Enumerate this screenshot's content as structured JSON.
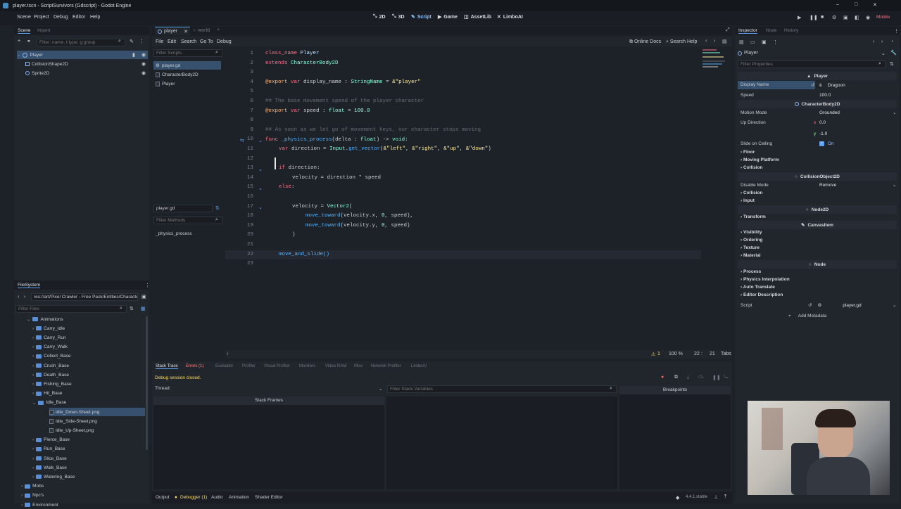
{
  "window": {
    "title": "player.tscn - ScriptSurvivors (Gdscript) - Godot Engine",
    "minimize": "–",
    "maximize": "□",
    "close": "✕"
  },
  "menu": {
    "scene": "Scene",
    "project": "Project",
    "debug": "Debug",
    "editor": "Editor",
    "help": "Help"
  },
  "workspaces": {
    "w2d": "2D",
    "w3d": "3D",
    "script": "Script",
    "game": "Game",
    "assetlib": "AssetLib",
    "limbo": "LimboAI"
  },
  "renderer": "Mobile",
  "scene_dock": {
    "tab_scene": "Scene",
    "tab_import": "Import",
    "filter_placeholder": "Filter: name, t:type, g:group",
    "nodes": [
      "Player",
      "CollisionShape2D",
      "Sprite2D"
    ]
  },
  "editor_tabs": {
    "tab1": "player",
    "tab2": "world"
  },
  "script_menu": {
    "file": "File",
    "edit": "Edit",
    "search": "Search",
    "goto": "Go To",
    "debug": "Debug",
    "online_docs": "Online Docs",
    "search_help": "Search Help"
  },
  "scripts_panel": {
    "filter_placeholder": "Filter Scripts",
    "items": [
      "player.gd",
      "CharacterBody2D",
      "Player"
    ],
    "current": "player.gd",
    "methods_placeholder": "Filter Methods",
    "methods": [
      "_physics_process"
    ]
  },
  "code": {
    "l1a": "class_name",
    "l1b": " Player",
    "l2a": "extends",
    "l2b": " CharacterBody2D",
    "l4a": "@export",
    "l4b": " var",
    "l4c": " display_name : ",
    "l4d": "StringName",
    "l4e": " = ",
    "l4f": "&\"player\"",
    "l6": "## The base movement speed of the player character",
    "l7a": "@export",
    "l7b": " var",
    "l7c": " speed : ",
    "l7d": "float",
    "l7e": " = ",
    "l7f": "100.0",
    "l9": "## As soon as we let go of movement keys, our character stops moving",
    "l10a": "func",
    "l10b": " _physics_process",
    "l10c": "(delta : ",
    "l10d": "float",
    "l10e": ") -> ",
    "l10f": "void",
    ":": ":",
    "l11a": "var",
    "l11b": " direction = ",
    "l11c": "Input",
    "l11d": ".",
    "l11e": "get_vector",
    "l11f": "(",
    "l11g": "&\"left\"",
    "l11h": ", ",
    "l11i": "&\"right\"",
    "l11j": ", ",
    "l11k": "&\"up\"",
    "l11l": ", ",
    "l11m": "&\"down\"",
    "l11n": ")",
    "l13a": "if",
    "l13b": " direction:",
    "l14": "velocity = direction * speed",
    "l15a": "else",
    "l17a": "velocity = ",
    "l17b": "Vector2",
    "l17c": "(",
    "l18a": "move_toward",
    "l18b": "(velocity.x, ",
    "l18c": "0",
    "l18d": ", speed),",
    "l19a": "move_toward",
    "l19b": "(velocity.y, ",
    "l19c": "0",
    "l19d": ", speed)",
    "l20": ")",
    "l22": "move_and_slide()"
  },
  "line_numbers": [
    "1",
    "2",
    "3",
    "4",
    "5",
    "6",
    "7",
    "8",
    "9",
    "10",
    "11",
    "12",
    "13",
    "14",
    "15",
    "16",
    "17",
    "18",
    "19",
    "20",
    "21",
    "22",
    "23"
  ],
  "code_status": {
    "warnings": "1",
    "zoom": "100 %",
    "line": "22",
    "col": "21",
    "indent": "Tabs"
  },
  "filesystem": {
    "title": "FileSystem",
    "path": "res://art/Pixel Crawler - Free Pack/Entities/Character",
    "filter_placeholder": "Filter Files",
    "items": [
      "Animations",
      "Carry_Idle",
      "Carry_Run",
      "Carry_Walk",
      "Collect_Base",
      "Crush_Base",
      "Death_Base",
      "Fishing_Base",
      "Hit_Base",
      "Idle_Base",
      "Idle_Down-Sheet.png",
      "Idle_Side-Sheet.png",
      "Idle_Up-Sheet.png",
      "Pierce_Base",
      "Run_Base",
      "Slice_Base",
      "Walk_Base",
      "Watering_Base",
      "Mobs",
      "Npc's",
      "Environment"
    ]
  },
  "debugger": {
    "tabs": [
      "Stack Trace",
      "Errors (1)",
      "Evaluator",
      "Profiler",
      "Visual Profiler",
      "Monitors",
      "Video RAM",
      "Misc",
      "Network Profiler",
      "LimboAI"
    ],
    "message": "Debug session closed.",
    "thread_label": "Thread:",
    "stack_vars_placeholder": "Filter Stack Variables",
    "stack_frames": "Stack Frames",
    "breakpoints": "Breakpoints"
  },
  "bottom_bar": {
    "output": "Output",
    "debugger": "Debugger (1)",
    "audio": "Audio",
    "animation": "Animation",
    "shader": "Shader Editor",
    "version": "4.4.1.stable"
  },
  "inspector": {
    "tab_inspector": "Inspector",
    "tab_node": "Node",
    "tab_history": "History",
    "object": "Player",
    "filter_placeholder": "Filter Properties",
    "sec_player": "Player",
    "display_name_label": "Display Name",
    "display_name_value": "Dragoon",
    "display_name_prefix": "&",
    "speed_label": "Speed",
    "speed_value": "100.0",
    "sec_cb": "CharacterBody2D",
    "motion_mode_label": "Motion Mode",
    "motion_mode_value": "Grounded",
    "up_dir_label": "Up Direction",
    "up_x_label": "x",
    "up_x": "0.0",
    "up_y_label": "y",
    "up_y": "-1.0",
    "slide_label": "Slide on Ceiling",
    "slide_value": "On",
    "g_floor": "Floor",
    "g_moving": "Moving Platform",
    "g_collision": "Collision",
    "sec_co": "CollisionObject2D",
    "disable_mode_label": "Disable Mode",
    "disable_mode_value": "Remove",
    "g_collision2": "Collision",
    "g_input": "Input",
    "sec_node2d": "Node2D",
    "g_transform": "Transform",
    "sec_canvas": "CanvasItem",
    "g_visibility": "Visibility",
    "g_ordering": "Ordering",
    "g_texture": "Texture",
    "g_material": "Material",
    "sec_node": "Node",
    "g_process": "Process",
    "g_physics": "Physics Interpolation",
    "g_auto": "Auto Translate",
    "g_editor": "Editor Description",
    "script_label": "Script",
    "script_value": "player.gd",
    "add_metadata": "Add Metadata"
  }
}
